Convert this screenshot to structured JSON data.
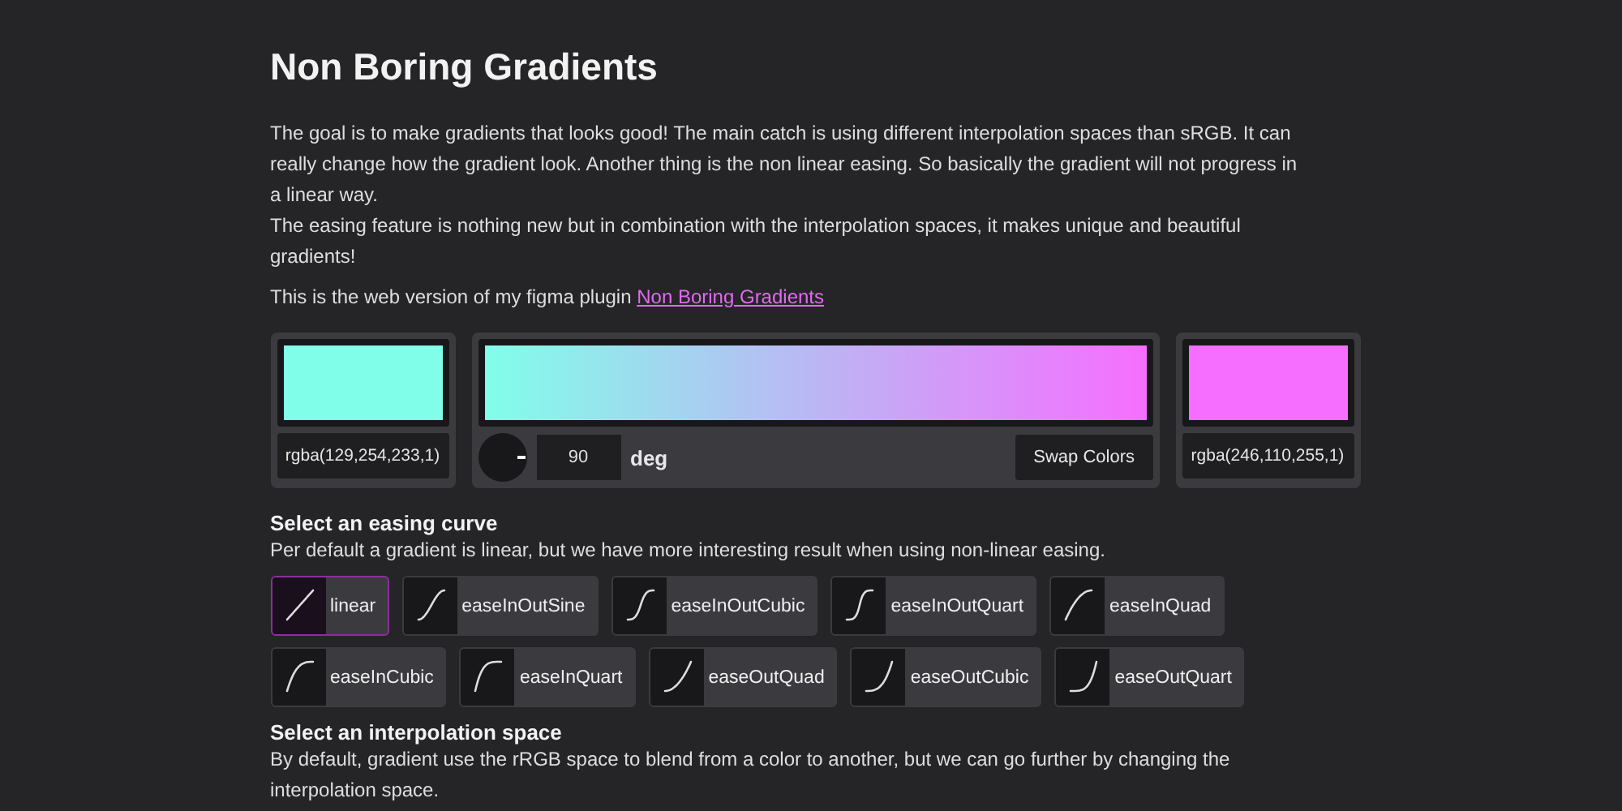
{
  "title": "Non Boring Gradients",
  "intro": [
    "The goal is to make gradients that looks good! The main catch is using different interpolation spaces than sRGB. It can really change how the gradient look. Another thing is the non linear easing. So basically the gradient will not progress in a linear way.",
    "The easing feature is nothing new but in combination with the interpolation spaces, it makes unique and beautiful gradients!"
  ],
  "plugin_line": {
    "text": "This is the web version of my figma plugin ",
    "link": "Non Boring Gradients"
  },
  "start_color": {
    "color": "#81fee9",
    "value": "rgba(129,254,233,1)"
  },
  "end_color": {
    "color": "#f66eff",
    "value": "rgba(246,110,255,1)"
  },
  "angle": {
    "value": "90",
    "unit": "deg"
  },
  "swap_button": "Swap Colors",
  "easing": {
    "heading": "Select an easing curve",
    "description": "Per default a gradient is linear, but we have more interesting result when using non-linear easing.",
    "options": [
      {
        "label": "linear",
        "kind": "linear",
        "selected": true
      },
      {
        "label": "easeInOutSine",
        "kind": "inOutSine",
        "selected": false
      },
      {
        "label": "easeInOutCubic",
        "kind": "inOutCubic",
        "selected": false
      },
      {
        "label": "easeInOutQuart",
        "kind": "inOutQuart",
        "selected": false
      },
      {
        "label": "easeInQuad",
        "kind": "outQuadRev",
        "selected": false
      },
      {
        "label": "easeInCubic",
        "kind": "outCubicRev",
        "selected": false
      },
      {
        "label": "easeInQuart",
        "kind": "outQuartRev",
        "selected": false
      },
      {
        "label": "easeOutQuad",
        "kind": "inQuadRev",
        "selected": false
      },
      {
        "label": "easeOutCubic",
        "kind": "inCubicRev",
        "selected": false
      },
      {
        "label": "easeOutQuart",
        "kind": "inQuartRev",
        "selected": false
      }
    ]
  },
  "interpolation": {
    "heading": "Select an interpolation space",
    "description": "By default, gradient use the rRGB space to blend from a color to another, but we can go further by changing the interpolation space."
  }
}
